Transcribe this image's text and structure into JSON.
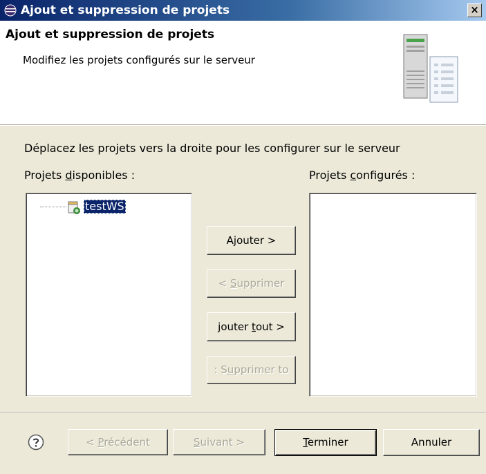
{
  "window": {
    "title": "Ajout et suppression de projets",
    "close_glyph": "×"
  },
  "banner": {
    "title": "Ajout et suppression de projets",
    "description": "Modifiez les projets configurés sur le serveur",
    "icon": "server-wizard-icon"
  },
  "body": {
    "instruction": "Déplacez les projets vers la droite pour les configurer sur le serveur",
    "available_label_pre": "Projets ",
    "available_label_u": "d",
    "available_label_post": "isponibles :",
    "configured_label_pre": "Projets ",
    "configured_label_u": "c",
    "configured_label_post": "onfigurés :",
    "available_projects": [
      {
        "label": "testWS",
        "icon": "project-icon",
        "selected": true
      }
    ],
    "configured_projects": []
  },
  "buttons": {
    "add": {
      "pre": "A",
      "u": "j",
      "post": "outer >",
      "enabled": true
    },
    "remove": {
      "pre": "< ",
      "u": "S",
      "post": "upprimer",
      "enabled": false
    },
    "add_all": {
      "pre": "jouter ",
      "u": "t",
      "post": "out >",
      "enabled": true
    },
    "remove_all": {
      "pre": ": S",
      "u": "u",
      "post": "pprimer to",
      "enabled": false
    }
  },
  "footer": {
    "help_icon": "help-icon",
    "back": {
      "pre": "< ",
      "u": "P",
      "post": "récédent",
      "enabled": false
    },
    "next": {
      "pre": "",
      "u": "S",
      "post": "uivant >",
      "enabled": false
    },
    "finish": {
      "pre": "",
      "u": "T",
      "post": "erminer",
      "enabled": true
    },
    "cancel": {
      "label": "Annuler",
      "enabled": true
    }
  },
  "colors": {
    "titlebar_start": "#0a246a",
    "titlebar_end": "#a6caf0",
    "dialog_bg": "#ece9d8",
    "selection_bg": "#0a246a",
    "disabled_text": "#aca899"
  }
}
